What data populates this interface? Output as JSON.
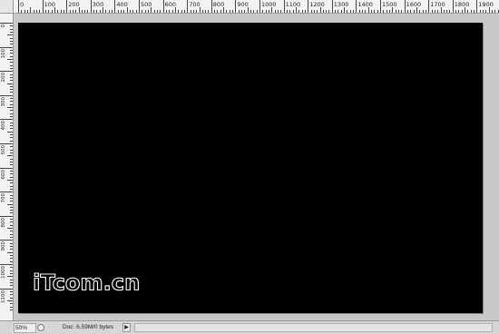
{
  "ruler": {
    "horizontal_labels": [
      "0",
      "100",
      "200",
      "300",
      "400",
      "500",
      "600",
      "700",
      "800",
      "900",
      "1000",
      "1100",
      "1200",
      "1300",
      "1400",
      "1500",
      "1600",
      "1700",
      "1800",
      "1900"
    ],
    "vertical_labels": [
      "0",
      "100",
      "200",
      "300",
      "400",
      "500",
      "600",
      "700",
      "800",
      "900",
      "1000",
      "1100"
    ]
  },
  "document": {
    "fill_color": "#000000",
    "watermark_text": "iTcom.cn"
  },
  "status": {
    "zoom": "50%",
    "doc_info": "Doc: 6.59M/0 bytes",
    "info_arrow": "▶"
  }
}
